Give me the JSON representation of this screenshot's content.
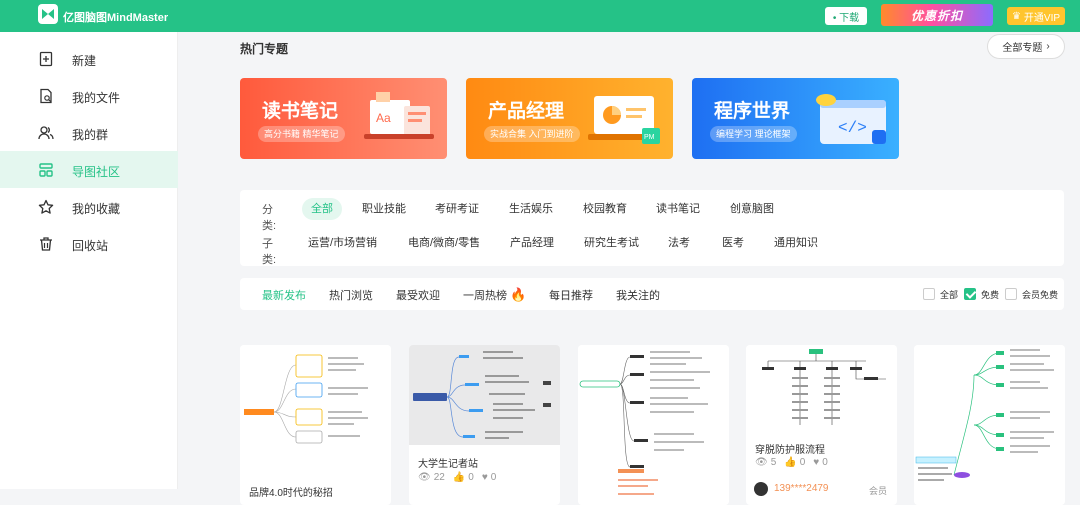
{
  "header": {
    "brand": "亿图脑图MindMaster",
    "download_label": "• 下载",
    "promo_label": "优惠折扣",
    "vip_label": "开通VIP"
  },
  "sidebar": {
    "items": [
      {
        "label": "新建",
        "icon": "new-file-icon"
      },
      {
        "label": "我的文件",
        "icon": "my-files-icon"
      },
      {
        "label": "我的群",
        "icon": "group-icon"
      },
      {
        "label": "导图社区",
        "icon": "community-icon",
        "active": true
      },
      {
        "label": "我的收藏",
        "icon": "star-icon"
      },
      {
        "label": "回收站",
        "icon": "trash-icon"
      }
    ]
  },
  "main": {
    "section_title": "热门专题",
    "all_topics_label": "全部专题",
    "banners": [
      {
        "title": "读书笔记",
        "subtitle": "高分书籍 精华笔记",
        "color": "#ff6a4d"
      },
      {
        "title": "产品经理",
        "subtitle": "实战合集 入门到进阶",
        "color": "#ff9a1f"
      },
      {
        "title": "程序世界",
        "subtitle": "编程学习 理论框架",
        "color": "#2c7ff7"
      }
    ],
    "filter": {
      "category_label": "分类:",
      "categories": [
        "全部",
        "职业技能",
        "考研考证",
        "生活娱乐",
        "校园教育",
        "读书笔记",
        "创意脑图"
      ],
      "subcategory_label": "子类:",
      "subcategories": [
        "运营/市场营销",
        "电商/微商/零售",
        "产品经理",
        "研究生考试",
        "法考",
        "医考",
        "通用知识"
      ]
    },
    "tabs": [
      "最新发布",
      "热门浏览",
      "最受欢迎",
      "一周热榜",
      "每日推荐",
      "我关注的"
    ],
    "checkbox_filters": [
      {
        "label": "全部",
        "checked": false
      },
      {
        "label": "免费",
        "checked": true
      },
      {
        "label": "会员免费",
        "checked": false
      }
    ],
    "cards": [
      {
        "title": "品牌4.0时代的秘招"
      },
      {
        "title": "大学生记者站",
        "views": "22",
        "likes": "0",
        "favorites": "0"
      },
      {
        "title": ""
      },
      {
        "title": "穿脱防护服流程",
        "views": "5",
        "likes": "0",
        "favorites": "0",
        "author": "139****2479",
        "more": "会员"
      },
      {
        "title": ""
      }
    ]
  },
  "colors": {
    "accent": "#25c287",
    "promo": "#ff4fa0",
    "vip": "#ffc52d"
  }
}
